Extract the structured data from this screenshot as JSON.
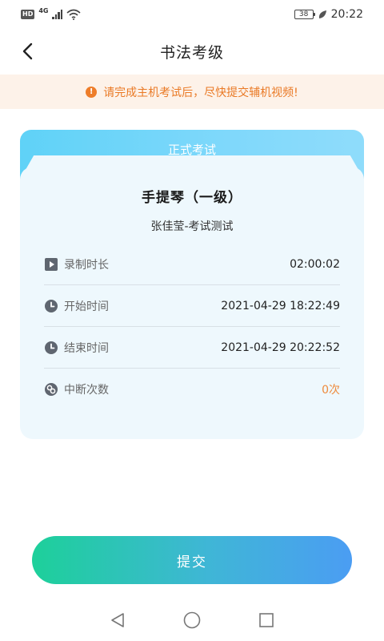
{
  "status_bar": {
    "hd": "HD",
    "network": "4G",
    "battery": "38",
    "time": "20:22"
  },
  "header": {
    "title": "书法考级"
  },
  "notice": {
    "icon": "alert-icon",
    "text": "请完成主机考试后，尽快提交辅机视频!"
  },
  "card": {
    "tab_label": "正式考试",
    "exam_title": "手提琴（一级）",
    "exam_subtitle": "张佳莹-考试测试",
    "rows": [
      {
        "icon": "play-icon",
        "label": "录制时长",
        "value": "02:00:02"
      },
      {
        "icon": "clock-icon",
        "label": "开始时间",
        "value": "2021-04-29 18:22:49"
      },
      {
        "icon": "clock-icon",
        "label": "结束时间",
        "value": "2021-04-29 20:22:52"
      },
      {
        "icon": "link-break-icon",
        "label": "中断次数",
        "value": "0次"
      }
    ]
  },
  "submit": {
    "label": "提交"
  },
  "colors": {
    "accent_warning": "#ea7a26",
    "tab_gradient_start": "#5fd2f7",
    "submit_gradient_start": "#1dd09a",
    "submit_gradient_end": "#4b9df3",
    "card_background": "#eef8fd"
  }
}
